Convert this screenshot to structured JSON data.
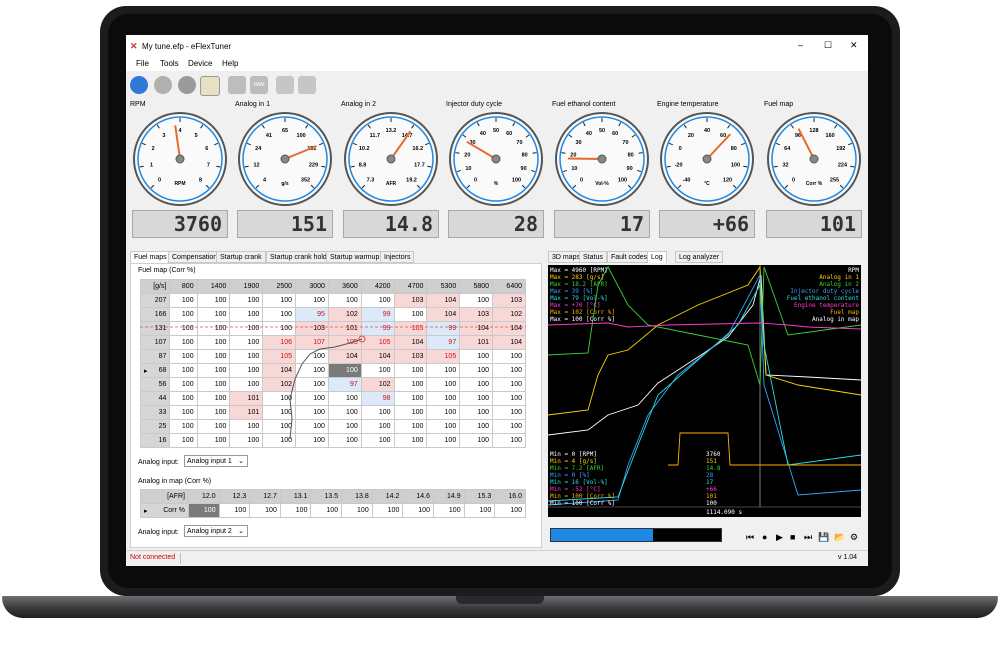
{
  "window": {
    "title": "My tune.efp - eFlexTuner",
    "minimize": "–",
    "maximize": "☐",
    "close": "✕"
  },
  "menu": [
    "File",
    "Tools",
    "Device",
    "Help"
  ],
  "toolbar": {
    "icons": [
      "connect-icon",
      "disconnect-icon",
      "settings-icon",
      "chart-icon",
      "write-icon",
      "ram-icon",
      "save-flash-icon",
      "load-flash-icon"
    ],
    "ram_label": "RAM"
  },
  "gauges": [
    {
      "title": "RPM",
      "ticks": [
        "0",
        "1",
        "2",
        "3",
        "4",
        "5",
        "6",
        "7",
        "8"
      ],
      "unit": "RPM",
      "value": "3760",
      "needle": 0.47
    },
    {
      "title": "Analog in 1",
      "ticks": [
        "4",
        "12",
        "24",
        "41",
        "65",
        "100",
        "151",
        "229",
        "352"
      ],
      "unit": "g/s",
      "value": "151",
      "needle": 0.75
    },
    {
      "title": "Analog in 2",
      "ticks": [
        "7.3",
        "8.8",
        "10.2",
        "11.7",
        "13.2",
        "14.7",
        "16.2",
        "17.7",
        "19.2"
      ],
      "unit": "AFR",
      "value": "14.8",
      "needle": 0.63
    },
    {
      "title": "Injector duty cycle",
      "ticks": [
        "0",
        "10",
        "20",
        "30",
        "40",
        "50",
        "60",
        "70",
        "80",
        "90",
        "100"
      ],
      "unit": "%",
      "value": "28",
      "needle": 0.28
    },
    {
      "title": "Fuel ethanol content",
      "ticks": [
        "0",
        "10",
        "20",
        "30",
        "40",
        "50",
        "60",
        "70",
        "80",
        "90",
        "100"
      ],
      "unit": "Vol-%",
      "value": "17",
      "needle": 0.17
    },
    {
      "title": "Engine temperature",
      "ticks": [
        "-40",
        "-20",
        "0",
        "20",
        "40",
        "60",
        "80",
        "100",
        "120"
      ],
      "unit": "°C",
      "value": "+66",
      "needle": 0.66
    },
    {
      "title": "Fuel map",
      "ticks": [
        "0",
        "32",
        "64",
        "96",
        "128",
        "160",
        "192",
        "224",
        "255"
      ],
      "unit": "Corr %",
      "value": "101",
      "needle": 0.4
    }
  ],
  "left_tabs": [
    "Fuel maps",
    "Compensation",
    "Startup crank",
    "Startup crank hold",
    "Startup warmup",
    "Injectors"
  ],
  "fuel_map": {
    "title": "Fuel map (Corr %)",
    "corner": "[g/s]",
    "columns": [
      "800",
      "1400",
      "1900",
      "2500",
      "3000",
      "3600",
      "4200",
      "4700",
      "5300",
      "5800",
      "6400"
    ],
    "rows": [
      {
        "h": "207",
        "v": [
          "100",
          "100",
          "100",
          "100",
          "100",
          "100",
          "100",
          "103",
          "104",
          "100",
          "103"
        ]
      },
      {
        "h": "166",
        "v": [
          "100",
          "100",
          "100",
          "100",
          "95",
          "102",
          "99",
          "100",
          "104",
          "103",
          "102"
        ]
      },
      {
        "h": "131",
        "v": [
          "100",
          "100",
          "100",
          "100",
          "103",
          "101",
          "99",
          "105",
          "99",
          "104",
          "104"
        ]
      },
      {
        "h": "107",
        "v": [
          "100",
          "100",
          "100",
          "106",
          "107",
          "105",
          "105",
          "104",
          "97",
          "101",
          "104"
        ]
      },
      {
        "h": "87",
        "v": [
          "100",
          "100",
          "100",
          "105",
          "100",
          "104",
          "104",
          "103",
          "105",
          "100",
          "100"
        ]
      },
      {
        "h": "68",
        "v": [
          "100",
          "100",
          "100",
          "104",
          "100",
          "100",
          "100",
          "100",
          "100",
          "100",
          "100"
        ]
      },
      {
        "h": "56",
        "v": [
          "100",
          "100",
          "100",
          "102",
          "100",
          "97",
          "102",
          "100",
          "100",
          "100",
          "100"
        ]
      },
      {
        "h": "44",
        "v": [
          "100",
          "100",
          "101",
          "100",
          "100",
          "100",
          "98",
          "100",
          "100",
          "100",
          "100"
        ]
      },
      {
        "h": "33",
        "v": [
          "100",
          "100",
          "101",
          "100",
          "100",
          "100",
          "100",
          "100",
          "100",
          "100",
          "100"
        ]
      },
      {
        "h": "25",
        "v": [
          "100",
          "100",
          "100",
          "100",
          "100",
          "100",
          "100",
          "100",
          "100",
          "100",
          "100"
        ]
      },
      {
        "h": "16",
        "v": [
          "100",
          "100",
          "100",
          "100",
          "100",
          "100",
          "100",
          "100",
          "100",
          "100",
          "100"
        ]
      }
    ],
    "row_marker": "▸"
  },
  "analog_input_label": "Analog input:",
  "analog_input_1": "Analog input 1",
  "analog_map": {
    "title": "Analog in map (Corr %)",
    "corner": "[AFR]",
    "columns": [
      "12.0",
      "12.3",
      "12.7",
      "13.1",
      "13.5",
      "13.8",
      "14.2",
      "14.6",
      "14.9",
      "15.3",
      "16.0"
    ],
    "row_label": "Corr %",
    "values": [
      "100",
      "100",
      "100",
      "100",
      "100",
      "100",
      "100",
      "100",
      "100",
      "100",
      "100"
    ]
  },
  "analog_input_2": "Analog input 2",
  "right_tabs": [
    "3D maps",
    "Status",
    "Fault codes",
    "Log",
    "Log analyzer"
  ],
  "log": {
    "max": [
      {
        "t": "Max = 4960 [RPM]",
        "c": "#ffffff"
      },
      {
        "t": "Max = 283 [g/s]",
        "c": "#ffd400"
      },
      {
        "t": "Max = 18.2 [AFR]",
        "c": "#3ad13a"
      },
      {
        "t": "Max = 39 [%]",
        "c": "#3aa0ff"
      },
      {
        "t": "Max = 79 [Vol-%]",
        "c": "#25e0e0"
      },
      {
        "t": "Max = +70 [°C]",
        "c": "#ff3ad0"
      },
      {
        "t": "Max = 102 [Corr %]",
        "c": "#ffb000"
      },
      {
        "t": "Max = 100 [Corr %]",
        "c": "#ffffff"
      }
    ],
    "legend": [
      {
        "t": "RPM",
        "c": "#ffffff"
      },
      {
        "t": "Analog in 1",
        "c": "#ffd400"
      },
      {
        "t": "Analog in 2",
        "c": "#3ad13a"
      },
      {
        "t": "Injector duty cycle",
        "c": "#3aa0ff"
      },
      {
        "t": "Fuel ethanol content",
        "c": "#25e0e0"
      },
      {
        "t": "Engine temperature",
        "c": "#ff3ad0"
      },
      {
        "t": "Fuel map",
        "c": "#ffb000"
      },
      {
        "t": "Analog in map",
        "c": "#ffffff"
      }
    ],
    "min": [
      {
        "t": "Min = 0 [RPM]",
        "c": "#ffffff"
      },
      {
        "t": "Min = 4 [g/s]",
        "c": "#ffd400"
      },
      {
        "t": "Min = 7.2 [AFR]",
        "c": "#3ad13a"
      },
      {
        "t": "Min = 0 [%]",
        "c": "#3aa0ff"
      },
      {
        "t": "Min = 16 [Vol-%]",
        "c": "#25e0e0"
      },
      {
        "t": "Min = -52 [°C]",
        "c": "#ff3ad0"
      },
      {
        "t": "Min = 100 [Corr %]",
        "c": "#ffb000"
      },
      {
        "t": "Min = 100 [Corr %]",
        "c": "#ffffff"
      }
    ],
    "cursor_values": [
      {
        "t": "3760",
        "c": "#ffffff"
      },
      {
        "t": "151",
        "c": "#ffd400"
      },
      {
        "t": "14.8",
        "c": "#3ad13a"
      },
      {
        "t": "28",
        "c": "#3aa0ff"
      },
      {
        "t": "17",
        "c": "#25e0e0"
      },
      {
        "t": "+66",
        "c": "#ff3ad0"
      },
      {
        "t": "101",
        "c": "#ffb000"
      },
      {
        "t": "100",
        "c": "#ffffff"
      }
    ],
    "time": "1114.090 s",
    "progress": 0.6
  },
  "playback": [
    "⏮",
    "●",
    "▶",
    "■",
    "⏭",
    "💾",
    "📂",
    "⚙"
  ],
  "status": {
    "connection": "Not connected",
    "version": "v 1.04"
  },
  "colors": {
    "accent": "#1e88e5",
    "needle": "#e86a2b",
    "status_red": "#cc0000"
  }
}
